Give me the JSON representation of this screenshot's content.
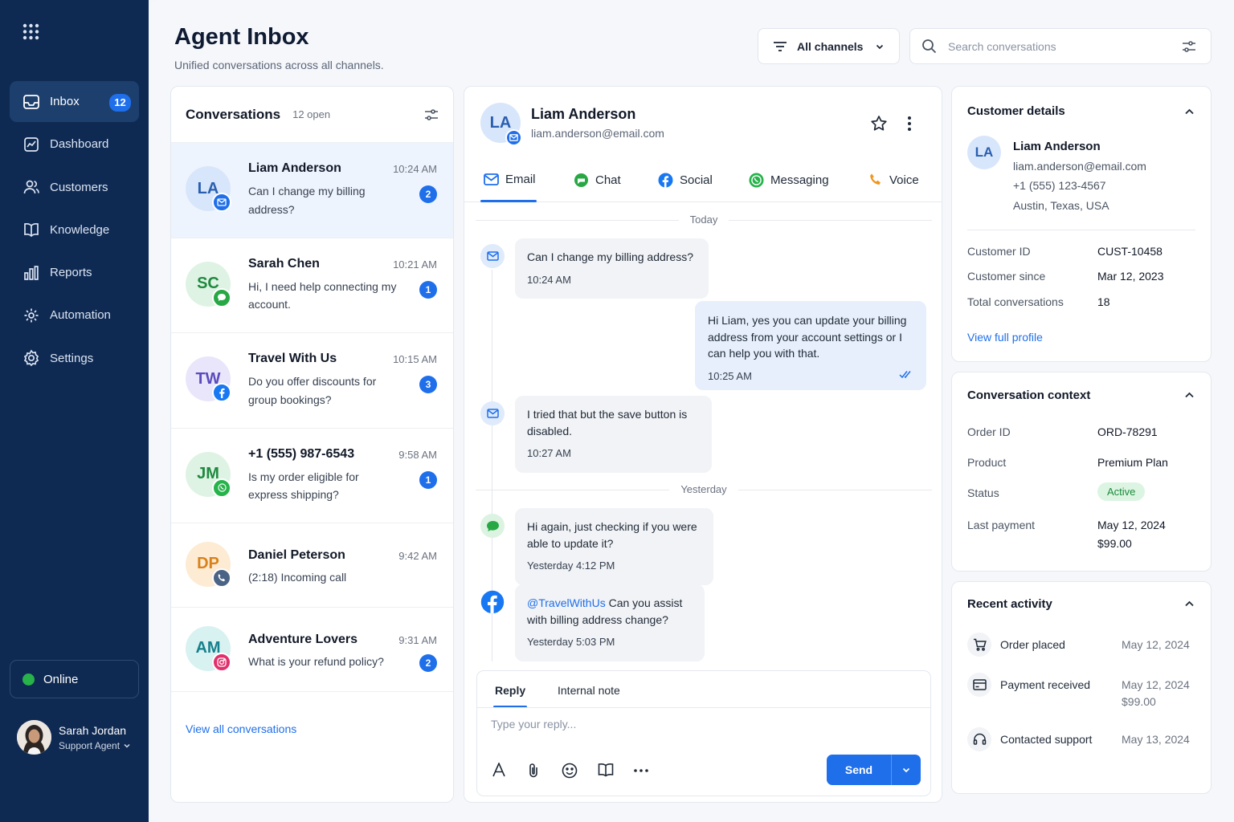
{
  "app": {
    "title": "Agent Inbox",
    "subtitle": "Unified conversations across all channels."
  },
  "sidebar": {
    "items": [
      {
        "label": "Inbox",
        "icon": "inbox-icon",
        "badge": "12",
        "active": true
      },
      {
        "label": "Dashboard",
        "icon": "dashboard-icon"
      },
      {
        "label": "Customers",
        "icon": "customers-icon"
      },
      {
        "label": "Knowledge",
        "icon": "knowledge-icon"
      },
      {
        "label": "Reports",
        "icon": "reports-icon"
      },
      {
        "label": "Automation",
        "icon": "automation-icon"
      },
      {
        "label": "Settings",
        "icon": "settings-icon"
      }
    ],
    "status": "Online",
    "user": {
      "name": "Sarah Jordan",
      "role": "Support Agent"
    }
  },
  "header": {
    "filter_label": "All channels",
    "search_placeholder": "Search conversations"
  },
  "conversations": {
    "title": "Conversations",
    "count": "12 open",
    "view_all": "View all conversations",
    "items": [
      {
        "initials": "LA",
        "name": "Liam Anderson",
        "time": "10:24 AM",
        "preview": "Can I change my billing address?",
        "badge": "2",
        "channel": "email-icon",
        "color": "#2a5fb0",
        "bg": "#d8e6fb"
      },
      {
        "initials": "SC",
        "name": "Sarah Chen",
        "time": "10:21 AM",
        "preview": "Hi, I need help connecting my account.",
        "badge": "1",
        "channel": "chat-icon",
        "color": "#1f8a3f",
        "bg": "#dff3e4"
      },
      {
        "initials": "TW",
        "name": "Travel With Us",
        "time": "10:15 AM",
        "preview": "Do you offer discounts for group bookings?",
        "badge": "3",
        "channel": "facebook-icon",
        "color": "#5b4bbd",
        "bg": "#e9e6fb"
      },
      {
        "initials": "JM",
        "name": "+1 (555) 987-6543",
        "time": "9:58 AM",
        "preview": "Is my order eligible for express shipping?",
        "badge": "1",
        "channel": "whatsapp-icon",
        "color": "#1f8a3f",
        "bg": "#dff3e4"
      },
      {
        "initials": "DP",
        "name": "Daniel Peterson",
        "time": "9:42 AM",
        "preview": "(2:18) Incoming call",
        "badge": "",
        "channel": "phone-icon",
        "color": "#d9821a",
        "bg": "#fdebd3"
      },
      {
        "initials": "AM",
        "name": "Adventure Lovers",
        "time": "9:31 AM",
        "preview": "What is your refund policy?",
        "badge": "2",
        "channel": "instagram-icon",
        "color": "#16808c",
        "bg": "#d8f1f1"
      }
    ]
  },
  "chat": {
    "contact": {
      "initials": "LA",
      "name": "Liam Anderson",
      "email": "liam.anderson@email.com"
    },
    "tabs": [
      "Email",
      "Chat",
      "Social",
      "Messaging",
      "Voice"
    ],
    "day_today": "Today",
    "day_yesterday": "Yesterday",
    "messages": [
      {
        "text": "Can I change my billing address?",
        "time": "10:24 AM"
      },
      {
        "text": "Hi Liam, yes you can update your billing address from your account settings or I can help you with that.",
        "time": "10:25 AM"
      },
      {
        "text": "I tried that but the save button is disabled.",
        "time": "10:27 AM"
      },
      {
        "text": "Hi again, just checking if you were able to update it?",
        "time": "Yesterday 4:12 PM"
      },
      {
        "mention": "@TravelWithUs",
        "text": " Can you assist with billing address change?",
        "time": "Yesterday 5:03 PM"
      }
    ],
    "reply": {
      "tab_reply": "Reply",
      "tab_note": "Internal note",
      "placeholder": "Type your reply...",
      "send": "Send"
    }
  },
  "customer": {
    "title": "Customer details",
    "initials": "LA",
    "name": "Liam Anderson",
    "email": "liam.anderson@email.com",
    "phone": "+1 (555) 123-4567",
    "location": "Austin, Texas, USA",
    "fields": [
      {
        "k": "Customer ID",
        "v": "CUST-10458"
      },
      {
        "k": "Customer since",
        "v": "Mar 12, 2023"
      },
      {
        "k": "Total conversations",
        "v": "18"
      }
    ],
    "link": "View full profile"
  },
  "context": {
    "title": "Conversation context",
    "order_k": "Order ID",
    "order_v": "ORD-78291",
    "product_k": "Product",
    "product_v": "Premium Plan",
    "status_k": "Status",
    "status_v": "Active",
    "payment_k": "Last payment",
    "payment_date": "May 12, 2024",
    "payment_amount": "$99.00"
  },
  "activity": {
    "title": "Recent activity",
    "items": [
      {
        "label": "Order placed",
        "date": "May 12, 2024",
        "icon": "cart-icon"
      },
      {
        "label": "Payment received",
        "date": "May 12, 2024",
        "amount": "$99.00",
        "icon": "card-icon"
      },
      {
        "label": "Contacted support",
        "date": "May 13, 2024",
        "icon": "headset-icon"
      }
    ]
  },
  "colors": {
    "sidebar": "#0f2a52",
    "accent": "#1f6feb",
    "active_status": "#1b8a3a"
  }
}
